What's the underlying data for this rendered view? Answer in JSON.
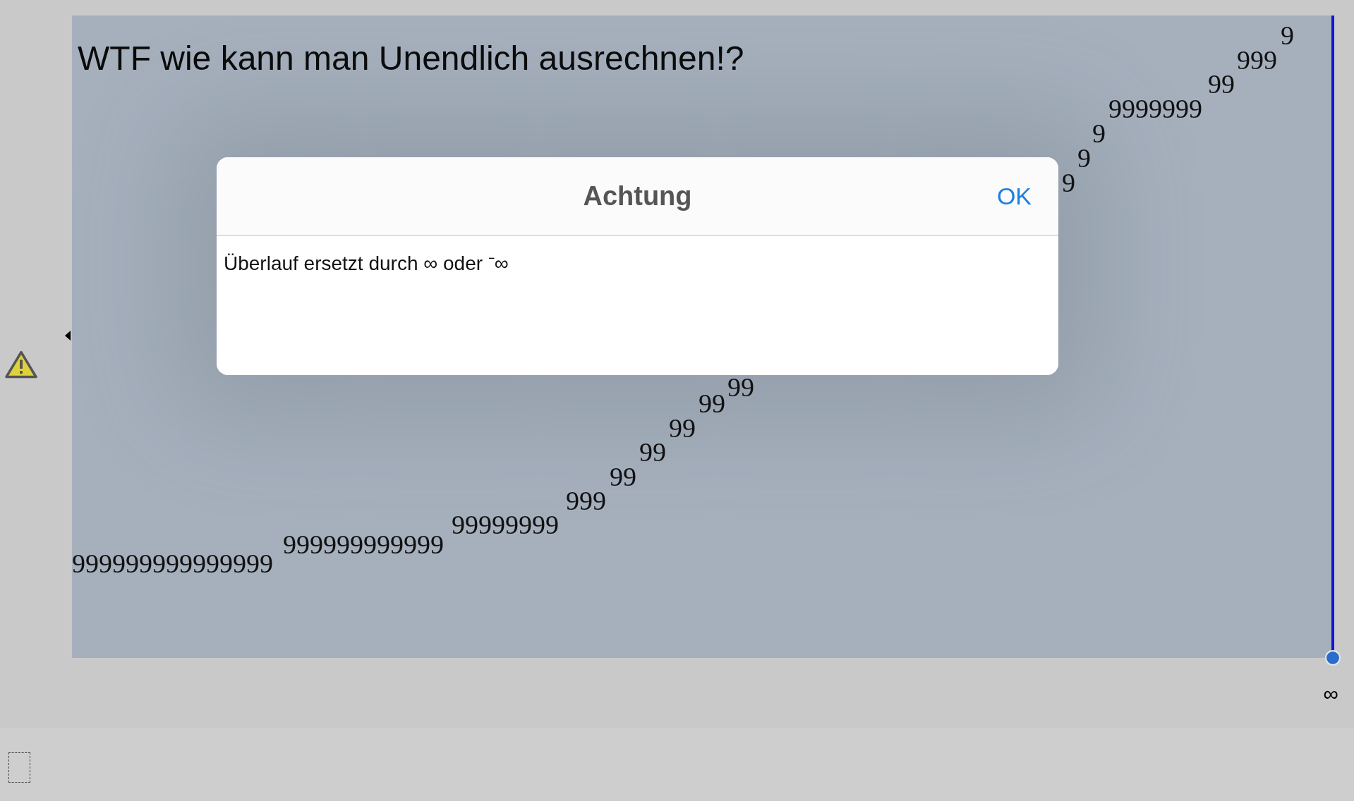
{
  "canvas": {
    "title": "WTF wie kann man Unendlich ausrechnen!?",
    "digit_trail": [
      "999999999999999",
      "999999999999",
      "99999999",
      "999",
      "99",
      "99",
      "99",
      "99",
      "99",
      "9",
      "9",
      "9",
      "9999999",
      "99",
      "999",
      "9"
    ]
  },
  "dialog": {
    "title": "Achtung",
    "button": "OK",
    "message": "Überlauf ersetzt durch ∞ oder ⁻∞"
  },
  "point": {
    "label": "∞"
  }
}
